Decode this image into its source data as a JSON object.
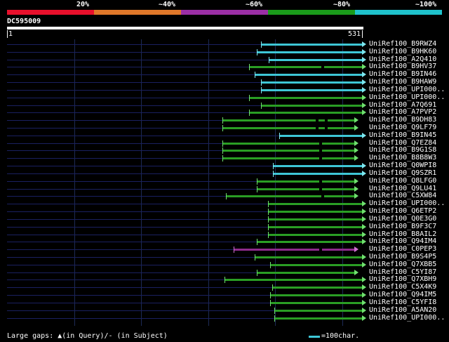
{
  "legend": [
    {
      "label": "20%",
      "color": "#e8102c"
    },
    {
      "label": "~40%",
      "color": "#e0782a"
    },
    {
      "label": "~60%",
      "color": "#9b2fa5"
    },
    {
      "label": "~80%",
      "color": "#1a9b1a"
    },
    {
      "label": "~100%",
      "color": "#1fc2cc"
    }
  ],
  "query": {
    "name": "DC595009",
    "start": "1",
    "end": "531"
  },
  "colors": {
    "cyan": "#3ec6d6",
    "green": "#2a9e24",
    "purple": "#8e2b8c",
    "cap_cyan": "#7fe8f0",
    "cap_green": "#70e070",
    "cap_purple": "#d070d0"
  },
  "hits": [
    {
      "label": "UniRef100_B9RWZ4",
      "start": 380,
      "end": 531,
      "color": "cyan"
    },
    {
      "label": "UniRef100_B9HK60",
      "start": 374,
      "end": 531,
      "color": "cyan"
    },
    {
      "label": "UniRef100_A2Q410",
      "start": 392,
      "end": 531,
      "color": "cyan"
    },
    {
      "label": "UniRef100_B9HV37",
      "start": 362,
      "end": 531,
      "color": "green",
      "gaps": [
        470
      ]
    },
    {
      "label": "UniRef100_B9IN46",
      "start": 371,
      "end": 531,
      "color": "cyan"
    },
    {
      "label": "UniRef100_B9HAW9",
      "start": 380,
      "end": 531,
      "color": "cyan"
    },
    {
      "label": "UniRef100_UPI000..",
      "start": 380,
      "end": 531,
      "color": "cyan"
    },
    {
      "label": "UniRef100_UPI000..",
      "start": 362,
      "end": 531,
      "color": "green"
    },
    {
      "label": "UniRef100_A7Q691",
      "start": 380,
      "end": 531,
      "color": "green"
    },
    {
      "label": "UniRef100_A7PVP2",
      "start": 362,
      "end": 531,
      "color": "green"
    },
    {
      "label": "UniRef100_B9DH83",
      "start": 323,
      "end": 520,
      "color": "green",
      "gaps": [
        462,
        475
      ]
    },
    {
      "label": "UniRef100_Q9LF79",
      "start": 323,
      "end": 520,
      "color": "green",
      "gaps": [
        462,
        475
      ]
    },
    {
      "label": "UniRef100_B9IN45",
      "start": 407,
      "end": 531,
      "color": "cyan"
    },
    {
      "label": "UniRef100_Q7EZ84",
      "start": 323,
      "end": 520,
      "color": "green",
      "gaps": [
        467
      ]
    },
    {
      "label": "UniRef100_B9G1S8",
      "start": 323,
      "end": 520,
      "color": "green",
      "gaps": [
        467
      ]
    },
    {
      "label": "UniRef100_B8B8W3",
      "start": 323,
      "end": 520,
      "color": "green",
      "gaps": [
        467
      ]
    },
    {
      "label": "UniRef100_Q0WPI8",
      "start": 398,
      "end": 531,
      "color": "cyan"
    },
    {
      "label": "UniRef100_Q9SZR1",
      "start": 398,
      "end": 531,
      "color": "cyan"
    },
    {
      "label": "UniRef100_Q8LFG0",
      "start": 374,
      "end": 520,
      "color": "green",
      "gaps": [
        467
      ]
    },
    {
      "label": "UniRef100_Q9LU41",
      "start": 374,
      "end": 520,
      "color": "green",
      "gaps": [
        467
      ]
    },
    {
      "label": "UniRef100_C5XW84",
      "start": 328,
      "end": 520,
      "color": "green",
      "gaps": [
        470
      ]
    },
    {
      "label": "UniRef100_UPI000..",
      "start": 391,
      "end": 531,
      "color": "green"
    },
    {
      "label": "UniRef100_Q6ETP2",
      "start": 391,
      "end": 531,
      "color": "green"
    },
    {
      "label": "UniRef100_Q0E3G0",
      "start": 391,
      "end": 531,
      "color": "green"
    },
    {
      "label": "UniRef100_B9F3C7",
      "start": 391,
      "end": 531,
      "color": "green"
    },
    {
      "label": "UniRef100_B8AIL2",
      "start": 391,
      "end": 531,
      "color": "green"
    },
    {
      "label": "UniRef100_Q94IM4",
      "start": 374,
      "end": 531,
      "color": "green"
    },
    {
      "label": "UniRef100_C0PEP3",
      "start": 339,
      "end": 520,
      "color": "purple",
      "gaps": [
        467
      ]
    },
    {
      "label": "UniRef100_B9S4P5",
      "start": 371,
      "end": 531,
      "color": "green"
    },
    {
      "label": "UniRef100_Q7XBB5",
      "start": 394,
      "end": 531,
      "color": "green"
    },
    {
      "label": "UniRef100_C5YI87",
      "start": 374,
      "end": 520,
      "color": "green"
    },
    {
      "label": "UniRef100_Q7XBH9",
      "start": 326,
      "end": 531,
      "color": "green"
    },
    {
      "label": "UniRef100_C5X4K9",
      "start": 397,
      "end": 531,
      "color": "green"
    },
    {
      "label": "UniRef100_Q94IM5",
      "start": 394,
      "end": 531,
      "color": "green"
    },
    {
      "label": "UniRef100_C5YFI8",
      "start": 394,
      "end": 531,
      "color": "green"
    },
    {
      "label": "UniRef100_A5AN20",
      "start": 400,
      "end": 531,
      "color": "green"
    },
    {
      "label": "UniRef100_UPI000..",
      "start": 400,
      "end": 531,
      "color": "green"
    }
  ],
  "footer": {
    "left": "Large gaps: ▲(in Query)/- (in Subject)",
    "right": "=100char."
  }
}
